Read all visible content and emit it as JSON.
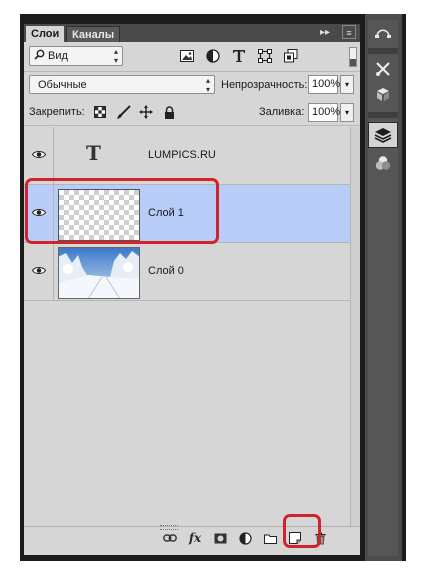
{
  "tabs": [
    {
      "label": "Слои",
      "active": true
    },
    {
      "label": "Каналы",
      "active": false
    }
  ],
  "tab_controls": {
    "collapse": "▸▸",
    "menu": "≡"
  },
  "filter": {
    "kind_icon": "search-icon",
    "kind_value": "Вид",
    "icons": [
      "image-filter-icon",
      "adjustment-filter-icon",
      "type-filter-icon",
      "shape-filter-icon",
      "smart-object-filter-icon"
    ]
  },
  "blend": {
    "mode": "Обычные",
    "opacity_label": "Непрозрачность:",
    "opacity_value": "100%"
  },
  "lock": {
    "label": "Закрепить:",
    "icons": [
      "lock-transparency-icon",
      "lock-pixels-icon",
      "lock-position-icon",
      "lock-all-icon"
    ],
    "fill_label": "Заливка:",
    "fill_value": "100%"
  },
  "layers": [
    {
      "name": "LUMPICS.RU",
      "type": "text",
      "thumb_glyph": "T",
      "visible": true,
      "selected": false
    },
    {
      "name": "Слой 1",
      "type": "transparent",
      "visible": true,
      "selected": true
    },
    {
      "name": "Слой 0",
      "type": "image",
      "visible": true,
      "selected": false
    }
  ],
  "footer_icons": [
    "link-layers-icon",
    "fx-icon",
    "add-mask-icon",
    "adjustment-layer-icon",
    "new-group-icon",
    "new-layer-icon",
    "delete-layer-icon"
  ],
  "fx_label": "fx",
  "dock_buttons": [
    "curves-icon",
    "tools-icon",
    "3d-icon",
    "layers-icon",
    "channels-icon"
  ],
  "colors": {
    "panel_bg": "#d6d6d6",
    "selected_row": "#b7cdf8",
    "highlight_ring": "#d2232a",
    "dark_chrome": "#1c1c1c"
  }
}
